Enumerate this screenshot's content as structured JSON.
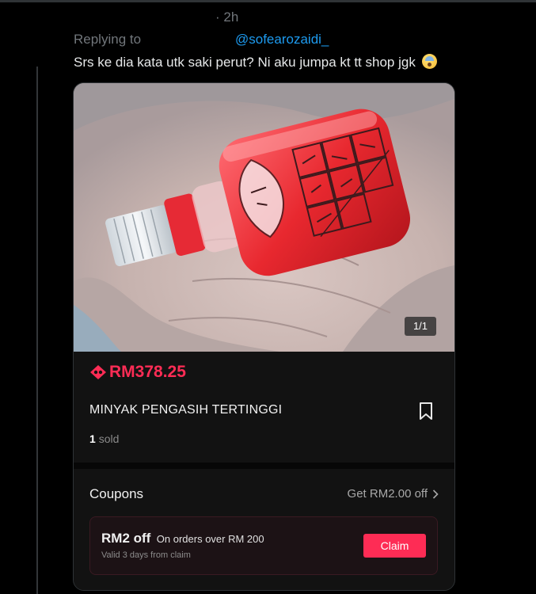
{
  "tweet": {
    "timestamp": "· 2h",
    "replying_label": "Replying to",
    "handle": "@sofearozaidi_",
    "text": "Srs ke dia kata utk saki perut? Ni aku jumpa kt tt shop jgk",
    "emoji": "anxious-face-with-sweat-emoji"
  },
  "product_card": {
    "image_counter": "1/1",
    "price": "RM378.25",
    "title": "MINYAK PENGASIH TERTINGGI",
    "sold_count": "1",
    "sold_label": "sold"
  },
  "coupons": {
    "title": "Coupons",
    "link": "Get RM2.00 off",
    "coupon": {
      "amount": "RM2 off",
      "condition": "On orders over RM 200",
      "validity": "Valid 3 days from claim",
      "claim_label": "Claim"
    }
  },
  "colors": {
    "accent_red": "#fe2c55",
    "link_blue": "#1d9bf0",
    "muted_text": "#71767b"
  }
}
